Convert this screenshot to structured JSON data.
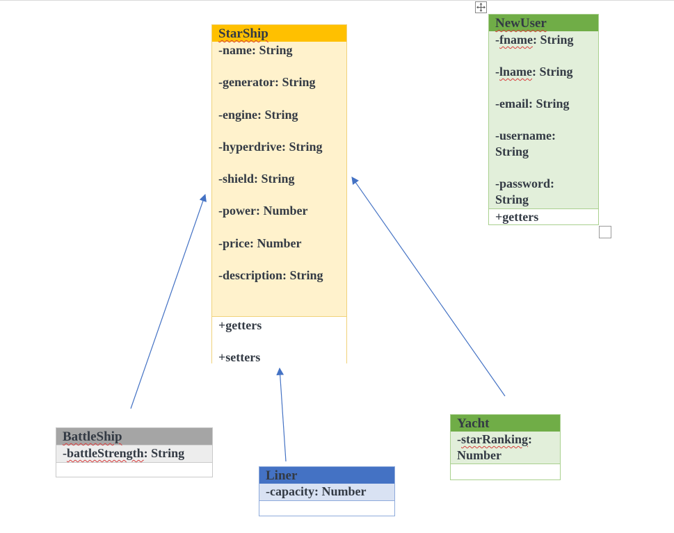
{
  "colors": {
    "starship_header": "#ffc000",
    "starship_body": "#fff2cc",
    "green_header": "#70ad47",
    "green_body": "#e2efda",
    "gray_header": "#a5a5a5",
    "blue_header": "#4472c4",
    "blue_body": "#d9e2f3",
    "arrow": "#4472c4"
  },
  "starship": {
    "name": "StarShip",
    "attributes": [
      "-name: String",
      "-generator: String",
      "-engine: String",
      "-hyperdrive: String",
      "-shield: String",
      "-power: Number",
      "-price: Number",
      "-description: String"
    ],
    "methods": [
      "+getters",
      "+setters"
    ]
  },
  "newuser": {
    "name": "NewUser",
    "attributes": [
      {
        "prefix": "-",
        "word": "fname",
        "rest": ": String"
      },
      {
        "prefix": "-",
        "word": "lname",
        "rest": ": String"
      },
      {
        "prefix": "-email: String",
        "word": "",
        "rest": ""
      },
      {
        "prefix": "-username: String",
        "word": "",
        "rest": ""
      },
      {
        "prefix": "-password: String",
        "word": "",
        "rest": ""
      }
    ],
    "methods": [
      "+getters"
    ]
  },
  "battleship": {
    "name": "BattleShip",
    "attr_prefix": "-",
    "attr_word": "battleStrength",
    "attr_rest": ": String"
  },
  "liner": {
    "name": "Liner",
    "attribute": "-capacity: Number"
  },
  "yacht": {
    "name": "Yacht",
    "attr_prefix": "-",
    "attr_word": "starRanking",
    "attr_rest": ": Number"
  },
  "icons": {
    "move_handle": "move-handle-icon",
    "resize_handle": "resize-handle-icon"
  }
}
